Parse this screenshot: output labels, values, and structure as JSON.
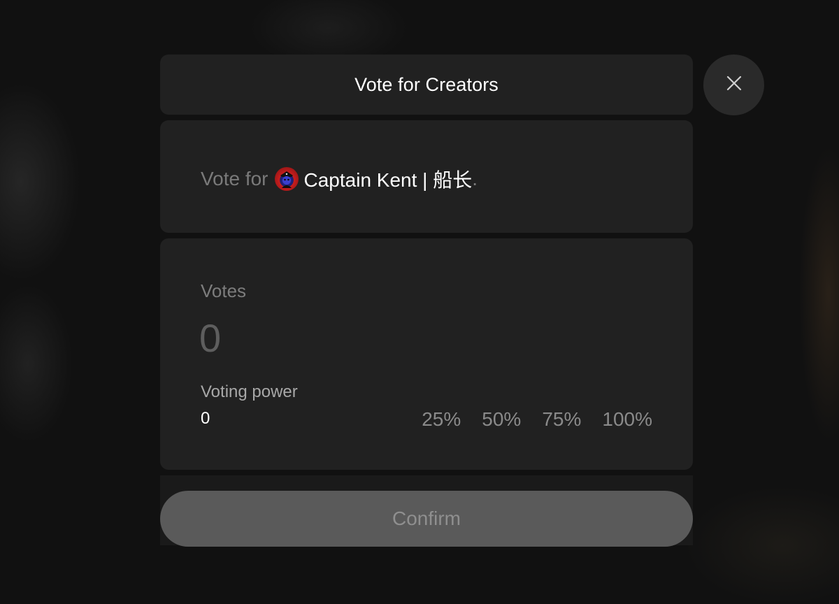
{
  "modal": {
    "title": "Vote for Creators",
    "target": {
      "prefix": "Vote for",
      "creator_name": "Captain Kent | 船长",
      "suffix": "."
    },
    "votes": {
      "label": "Votes",
      "value": "0"
    },
    "voting_power": {
      "label": "Voting power",
      "value": "0"
    },
    "percent_options": [
      "25%",
      "50%",
      "75%",
      "100%"
    ],
    "confirm_label": "Confirm"
  },
  "icons": {
    "close": "close-icon",
    "avatar": "captain-avatar"
  },
  "colors": {
    "card_bg": "#212121",
    "confirm_bg": "#5a5a5a",
    "text_primary": "#ffffff",
    "text_muted": "#7a7a7a"
  }
}
